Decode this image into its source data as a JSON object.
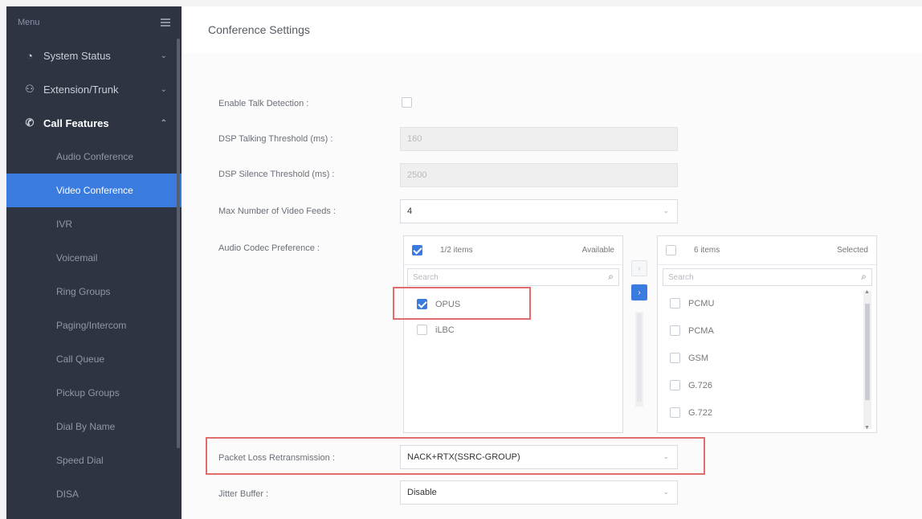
{
  "sidebar": {
    "header_label": "Menu",
    "items": [
      {
        "label": "System Status",
        "icon": "system-status-icon"
      },
      {
        "label": "Extension/Trunk",
        "icon": "extension-trunk-icon"
      },
      {
        "label": "Call Features",
        "icon": "phone-icon"
      }
    ],
    "sub_items": [
      "Audio Conference",
      "Video Conference",
      "IVR",
      "Voicemail",
      "Ring Groups",
      "Paging/Intercom",
      "Call Queue",
      "Pickup Groups",
      "Dial By Name",
      "Speed Dial",
      "DISA"
    ],
    "active_sub": "Video Conference"
  },
  "page": {
    "title": "Conference Settings"
  },
  "form": {
    "talk_detection": {
      "label": "Enable Talk Detection :",
      "checked": false
    },
    "talking_threshold": {
      "label": "DSP Talking Threshold (ms) :",
      "value": "160"
    },
    "silence_threshold": {
      "label": "DSP Silence Threshold (ms) :",
      "value": "2500"
    },
    "max_feeds": {
      "label": "Max Number of Video Feeds :",
      "value": "4"
    },
    "codec_pref": {
      "label": "Audio Codec Preference :",
      "available": {
        "count": "1/2 items",
        "title": "Available",
        "search_placeholder": "Search",
        "items": [
          "OPUS",
          "iLBC"
        ]
      },
      "selected": {
        "count": "6 items",
        "title": "Selected",
        "search_placeholder": "Search",
        "items": [
          "PCMU",
          "PCMA",
          "GSM",
          "G.726",
          "G.722"
        ]
      }
    },
    "packet_loss": {
      "label": "Packet Loss Retransmission :",
      "value": "NACK+RTX(SSRC-GROUP)"
    },
    "jitter_buffer": {
      "label": "Jitter Buffer :",
      "value": "Disable"
    }
  },
  "colors": {
    "sidebar": "#2f3442",
    "accent": "#3a7be0",
    "highlight": "#e06c6c"
  }
}
